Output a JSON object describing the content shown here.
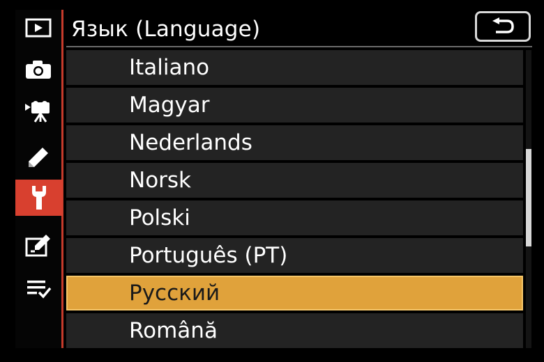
{
  "header": {
    "title": "Язык (Language)",
    "back_icon": "return-arrow-icon"
  },
  "sidebar": {
    "items": [
      {
        "icon": "playback-icon",
        "active": false
      },
      {
        "icon": "camera-icon",
        "active": false
      },
      {
        "icon": "movie-camera-icon",
        "active": false
      },
      {
        "icon": "pencil-icon",
        "active": false
      },
      {
        "icon": "wrench-icon",
        "active": true
      },
      {
        "icon": "retouch-icon",
        "active": false
      },
      {
        "icon": "my-menu-icon",
        "active": false
      }
    ]
  },
  "languages": {
    "items": [
      {
        "label": "Italiano",
        "selected": false
      },
      {
        "label": "Magyar",
        "selected": false
      },
      {
        "label": "Nederlands",
        "selected": false
      },
      {
        "label": "Norsk",
        "selected": false
      },
      {
        "label": "Polski",
        "selected": false
      },
      {
        "label": "Português (PT)",
        "selected": false
      },
      {
        "label": "Русский",
        "selected": true
      },
      {
        "label": "Română",
        "selected": false
      }
    ]
  },
  "colors": {
    "accent_red": "#d8402f",
    "selection_gold": "#e0a23b",
    "row_bg": "#232323",
    "background": "#000000"
  }
}
